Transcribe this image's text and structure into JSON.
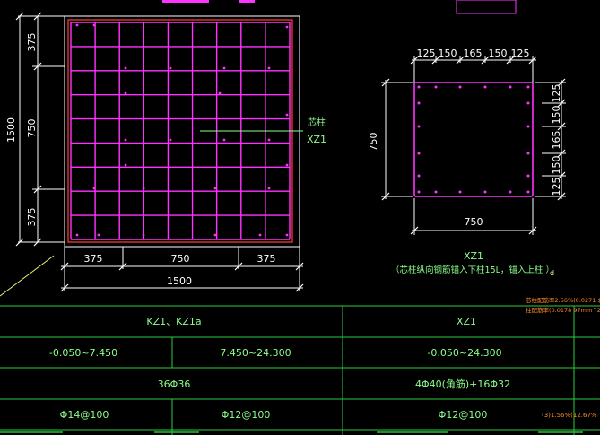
{
  "colors": {
    "background": "#000000",
    "dimension": "#ffffff",
    "frame": "#ff3333",
    "rebar": "#ff33ff",
    "text_green": "#8cff8c",
    "table_line": "#2ecc40",
    "annotation_orange": "#ff8a2a",
    "leader_yellow": "#f0f07a"
  },
  "main_section": {
    "left_dims": [
      "375",
      "750",
      "375"
    ],
    "left_total": "1500",
    "bottom_dims": [
      "375",
      "750",
      "375"
    ],
    "bottom_total": "1500",
    "core_label": "芯柱",
    "core_name": "XZ1"
  },
  "xz1_section": {
    "top_dims": [
      "125",
      "150",
      "165",
      "150",
      "125"
    ],
    "right_dims": [
      "125",
      "150",
      "165",
      "150",
      "125"
    ],
    "left_dim": "750",
    "bottom_dim": "750",
    "title": "XZ1",
    "note": "（芯柱纵向钢筋锚入下柱15L，锚入上柱 ）",
    "note_mark": "d"
  },
  "table": {
    "col1_header": "KZ1、KZ1a",
    "col2_header": "XZ1",
    "elevations": [
      "-0.050~7.450",
      "7.450~24.300",
      "-0.050~24.300"
    ],
    "main_rebar": [
      "36Φ36",
      "4Φ40(角筋)+16Φ32"
    ],
    "stirrups": [
      "Φ14@100",
      "Φ12@100",
      "Φ12@100"
    ],
    "side_note_1": "芯柱配筋率2.56%(0.0271 $",
    "side_note_2": "柱配筋率(0.0178 97mm^2)",
    "bottom_ratio": "(3)1.56%(12.67%"
  }
}
